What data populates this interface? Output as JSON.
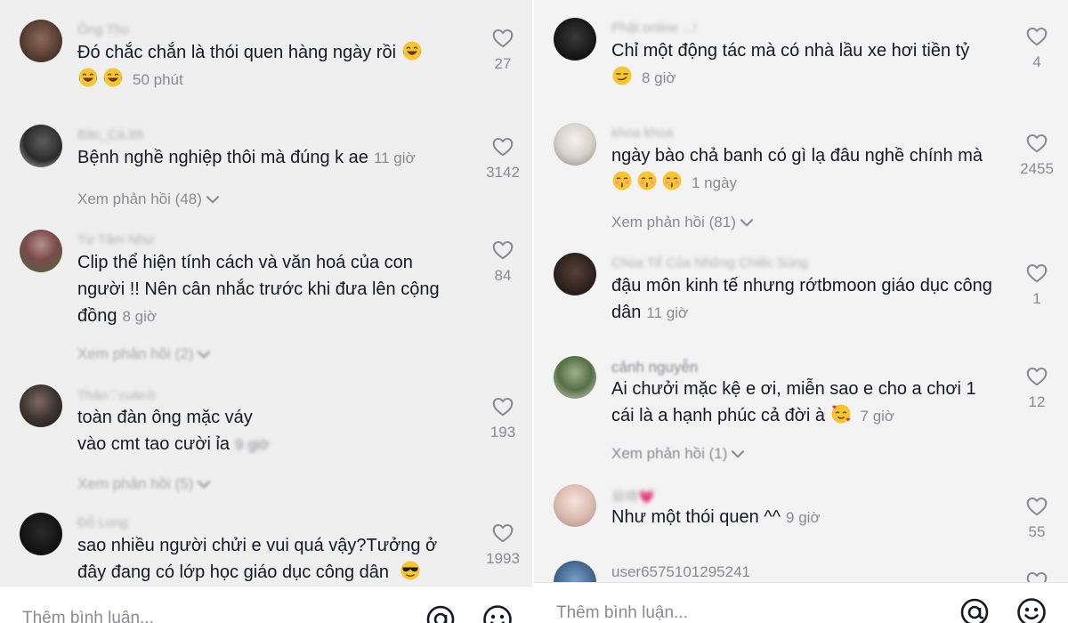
{
  "left": {
    "comments": [
      {
        "username": "Ông Thọ",
        "text": "Đó chắc chắn là thói quen hàng ngày rồi",
        "time": "50 phút",
        "likes": "27"
      },
      {
        "username": "Bác_Cá.89",
        "text": "Bệnh nghề nghiệp thôi mà đúng k ae",
        "time": "11 giờ",
        "likes": "3142",
        "replies": "Xem phản hồi (48)"
      },
      {
        "username": "Từ Tâm Như",
        "text": "Clip thể hiện tính cách và văn hoá của con người !! Nên cân nhắc trước khi đưa lên cộng đồng",
        "time": "8 giờ",
        "likes": "84",
        "replies": "Xem phản hồi (2)"
      },
      {
        "username": "Thảo♡cute♔",
        "text": "toàn đàn ông mặc váy vào cmt tao cười ỉa",
        "time": "9 giờ",
        "likes": "193",
        "replies": "Xem phản hồi (5)"
      },
      {
        "username": "Đỗ Long",
        "text": "sao nhiều người chửi e vui quá vậy?Tưởng ở đây đang có lớp học giáo dục công dân",
        "time": "",
        "likes": "1993"
      }
    ],
    "input_placeholder": "Thêm bình luận..."
  },
  "right": {
    "comments": [
      {
        "username": "Phật online ...!",
        "text": "Chỉ một động tác mà có nhà lầu xe hơi tiền tỷ",
        "time": "8 giờ",
        "likes": "4"
      },
      {
        "username": "khoa khoa",
        "text": "ngày bào chả banh có gì lạ đâu nghề chính mà",
        "time": "1 ngày",
        "likes": "2455",
        "replies": "Xem phản hồi (81)"
      },
      {
        "username": "Chúa Tể Của Những Chiếc Súng",
        "text": "đậu môn kinh tế nhưng rớtbmoon giáo dục công dân",
        "time": "11 giờ",
        "likes": "1"
      },
      {
        "username": "cảnh nguyễn",
        "text": "Ai chưởi mặc kệ e ơi, miễn sao e cho a chơi 1 cái là a hạnh phúc cả đời à",
        "time": "7 giờ",
        "likes": "12",
        "replies": "Xem phản hồi (1)"
      },
      {
        "username": "易晴💗",
        "text": "Như một thói quen ^^",
        "time": "9 giờ",
        "likes": "55"
      },
      {
        "username": "user6575101295241",
        "text": "",
        "time": "",
        "likes": ""
      }
    ],
    "input_placeholder": "Thêm bình luận..."
  },
  "icons": {
    "like": "heart-outline-icon",
    "replies_toggle": "chevron-down-icon",
    "mention": "at-sign-icon",
    "emoji_picker": "smiley-icon"
  },
  "colors": {
    "text": "#161823",
    "muted": "#8a8b91",
    "background": "#efefef"
  }
}
